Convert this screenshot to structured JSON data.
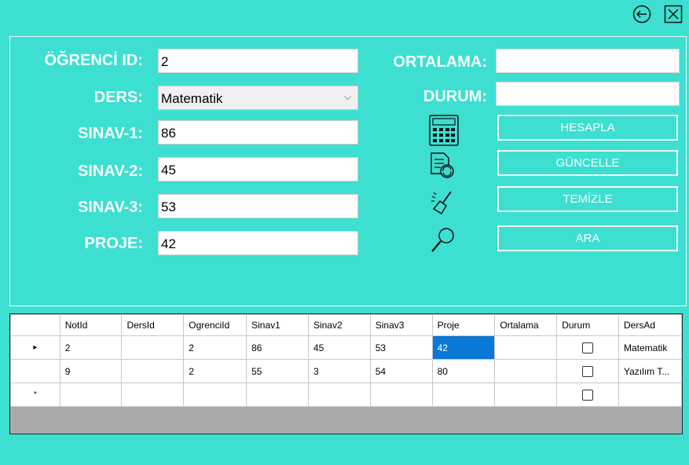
{
  "window": {
    "back_icon": "back-arrow-icon",
    "close_icon": "close-icon"
  },
  "form": {
    "ogrenci_id_label": "ÖĞRENCİ ID:",
    "ogrenci_id_value": "2",
    "ders_label": "DERS:",
    "ders_value": "Matematik",
    "sinav1_label": "SINAV-1:",
    "sinav1_value": "86",
    "sinav2_label": "SINAV-2:",
    "sinav2_value": "45",
    "sinav3_label": "SINAV-3:",
    "sinav3_value": "53",
    "proje_label": "PROJE:",
    "proje_value": "42",
    "ortalama_label": "ORTALAMA:",
    "ortalama_value": "",
    "durum_label": "DURUM:",
    "durum_value": ""
  },
  "actions": {
    "hesapla": "HESAPLA",
    "guncelle": "GÜNCELLE",
    "temizle": "TEMİZLE",
    "ara": "ARA",
    "icons": [
      "calculator-icon",
      "document-refresh-icon",
      "broom-icon",
      "magnifier-icon"
    ]
  },
  "grid": {
    "columns": [
      "NotId",
      "DersId",
      "OgrenciId",
      "Sinav1",
      "Sinav2",
      "Sinav3",
      "Proje",
      "Ortalama",
      "Durum",
      "DersAd"
    ],
    "rows": [
      {
        "indicator": "▸",
        "cells": [
          "2",
          "",
          "2",
          "86",
          "45",
          "53",
          "42",
          "",
          "",
          "Matematik"
        ]
      },
      {
        "indicator": "",
        "cells": [
          "9",
          "",
          "2",
          "55",
          "3",
          "54",
          "80",
          "",
          "",
          "Yazılım T..."
        ]
      },
      {
        "indicator": "*",
        "cells": [
          "",
          "",
          "",
          "",
          "",
          "",
          "",
          "",
          "",
          ""
        ]
      }
    ],
    "selected_cell": {
      "row": 0,
      "col": 6
    }
  }
}
